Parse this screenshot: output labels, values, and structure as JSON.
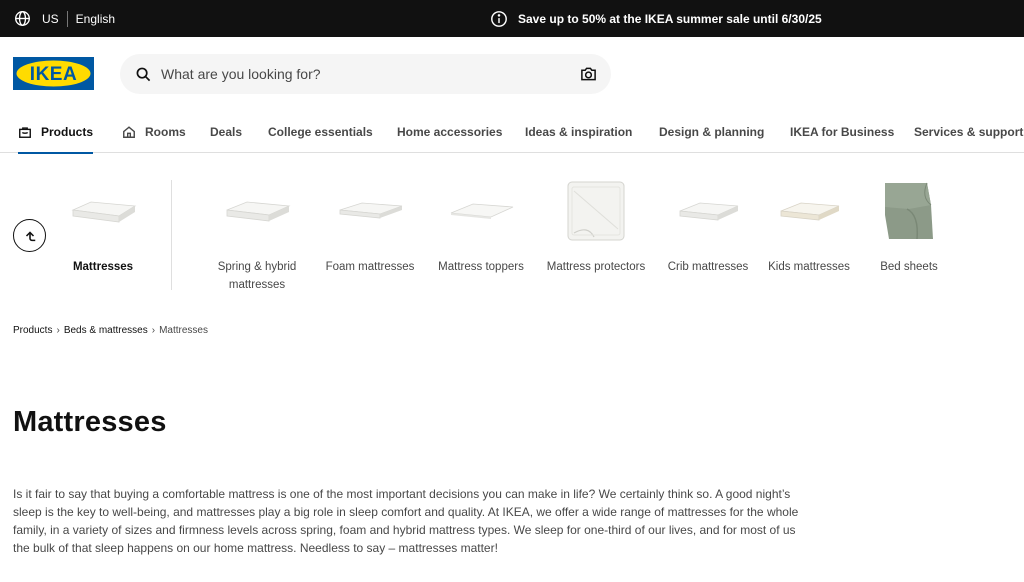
{
  "topbar": {
    "country": "US",
    "language": "English",
    "promo": "Save up to 50% at the IKEA summer sale until 6/30/25"
  },
  "brand": {
    "logo_text": "IKEA",
    "logo_blue": "#0058a3",
    "logo_yellow": "#ffdb00"
  },
  "search": {
    "placeholder": "What are you looking for?"
  },
  "nav": [
    {
      "label": "Products",
      "icon": "shopping-bag-icon",
      "active": true
    },
    {
      "label": "Rooms",
      "icon": "house-icon"
    },
    {
      "label": "Deals"
    },
    {
      "label": "College essentials"
    },
    {
      "label": "Home accessories"
    },
    {
      "label": "Ideas & inspiration"
    },
    {
      "label": "Design & planning"
    },
    {
      "label": "IKEA for Business"
    },
    {
      "label": "Services & support"
    }
  ],
  "categories": [
    {
      "label": "Mattresses",
      "current": true
    },
    {
      "label": "Spring & hybrid mattresses"
    },
    {
      "label": "Foam mattresses"
    },
    {
      "label": "Mattress toppers"
    },
    {
      "label": "Mattress protectors"
    },
    {
      "label": "Crib mattresses"
    },
    {
      "label": "Kids mattresses"
    },
    {
      "label": "Bed sheets"
    }
  ],
  "breadcrumb": [
    "Products",
    "Beds & mattresses",
    "Mattresses"
  ],
  "page": {
    "title": "Mattresses",
    "description": "Is it fair to say that buying a comfortable mattress is one of the most important decisions you can make in life? We certainly think so. A good night’s sleep is the key to well-being, and mattresses play a big role in sleep comfort and quality. At IKEA, we offer a wide range of mattresses for the whole family, in a variety of sizes and firmness levels across spring, foam and hybrid mattress types. We sleep for one-third of our lives, and for most of us the bulk of that sleep happens on our home mattress. Needless to say – mattresses matter!"
  }
}
